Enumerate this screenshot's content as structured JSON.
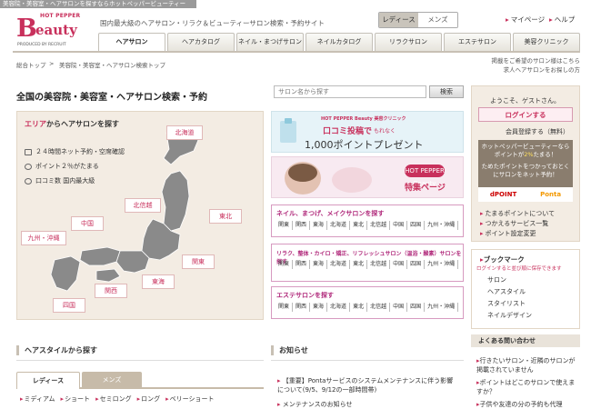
{
  "topbar": {
    "text": "美容院・美容室・ヘアサロンを探すならホットペッパービューティー"
  },
  "logo": {
    "hp": "HOT PEPPER",
    "b": "B",
    "beauty": "eauty",
    "prod": "PRODUCED BY RECRUIT"
  },
  "tagline": "国内最大級のヘアサロン・リラク＆ビューティーサロン検索・予約サイト",
  "gender": {
    "ladies": "レディース",
    "mens": "メンズ"
  },
  "util": {
    "mypage": "マイページ",
    "help": "ヘルプ"
  },
  "nav": [
    "ヘアサロン",
    "ヘアカタログ",
    "ネイル・まつげサロン",
    "ネイルカタログ",
    "リラクサロン",
    "エステサロン",
    "美容クリニック"
  ],
  "breadcrumb": {
    "home": "総合トップ",
    "sep": ">",
    "current": "美容院・美容室・ヘアサロン検索トップ"
  },
  "right_note": {
    "line1": "掲載をご希望のサロン様はこちら",
    "line2": "求人ヘアサロンをお探しの方"
  },
  "page_title": "全国の美容院・美容室・ヘアサロン検索・予約",
  "search": {
    "placeholder": "サロン名から探す",
    "button": "検索"
  },
  "area": {
    "title_em": "エリア",
    "title_rest": "からヘアサロンを探す",
    "features": [
      "２４時間ネット予約・空席確認",
      "ポイント２％がたまる",
      "口コミ数 国内最大級"
    ],
    "regions": [
      "北海道",
      "東北",
      "北信越",
      "関東",
      "中国",
      "九州・沖縄",
      "東海",
      "関西",
      "四国"
    ]
  },
  "banner_clinic": {
    "brand": "HOT PEPPER Beauty 美容クリニック",
    "headline": "口コミ投稿で",
    "sub": "もれなく",
    "points": "1,000ポイントプレゼント"
  },
  "banner_feature": {
    "brand": "HOT PEPPER Beauty",
    "text": "特集ページ"
  },
  "categories": [
    {
      "title": "ネイル、まつげ、メイクサロンを探す",
      "links": [
        "関東",
        "関西",
        "東海",
        "北海道",
        "東北",
        "北信越",
        "中国",
        "四国",
        "九州・沖縄"
      ]
    },
    {
      "title": "リラク、整体・カイロ・矯正、リフレッシュサロン（温浴・酸素）サロンを探す",
      "links": [
        "関東",
        "関西",
        "東海",
        "北海道",
        "東北",
        "北信越",
        "中国",
        "四国",
        "九州・沖縄"
      ]
    },
    {
      "title": "エステサロンを探す",
      "links": [
        "関東",
        "関西",
        "東海",
        "北海道",
        "東北",
        "北信越",
        "中国",
        "四国",
        "九州・沖縄"
      ]
    }
  ],
  "hairstyle": {
    "title": "ヘアスタイルから探す",
    "tab_ladies": "レディース",
    "tab_mens": "メンズ",
    "links": [
      "ミディアム",
      "ショート",
      "セミロング",
      "ロング",
      "ベリーショート"
    ]
  },
  "news": {
    "title": "お知らせ",
    "items": [
      "【重要】Pontaサービスのシステムメンテナンスに伴う影響について(9/5、9/12の一部時間帯)",
      "メンテナンスのお知らせ"
    ]
  },
  "sidebar": {
    "welcome": "ようこそ、ゲストさん。",
    "login": "ログインする",
    "register": "会員登録する（無料）",
    "point_banner": {
      "l1": "ホットペッパービューティーなら",
      "l2a": "ポイントが",
      "l2b": "2%",
      "l2c": "たまる！",
      "l3": "ためたポイントをつかっておとく",
      "l4": "にサロンをネット予約！"
    },
    "dpoint": "dPOINT",
    "ponta": "Ponta",
    "links": [
      "たまるポイントについて",
      "つかえるサービス一覧",
      "ポイント設定変更"
    ],
    "bookmark": {
      "title": "ブックマーク",
      "note": "ログインすると並び順に保存できます",
      "items": [
        "サロン",
        "ヘアスタイル",
        "スタイリスト",
        "ネイルデザイン"
      ]
    },
    "faq": {
      "title": "よくある問い合わせ",
      "items": [
        "行きたいサロン・近隣のサロンが掲載されていません",
        "ポイントはどこのサロンで使えますか？",
        "子供や友達の分の予約も代理"
      ]
    }
  }
}
